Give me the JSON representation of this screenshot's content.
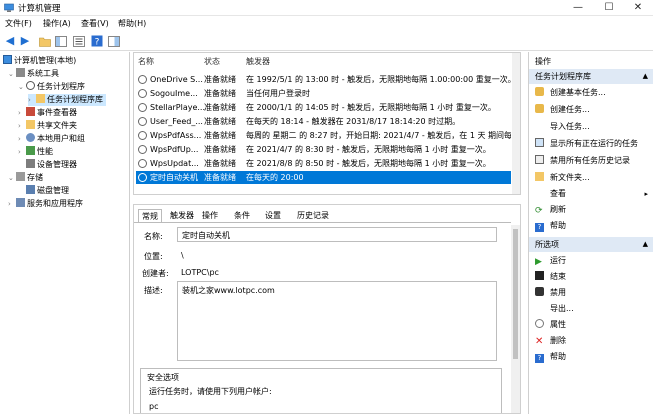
{
  "window": {
    "title": "计算机管理",
    "minimize": "—",
    "maximize": "☐",
    "close": "✕"
  },
  "menu": [
    "文件(F)",
    "操作(A)",
    "查看(V)",
    "帮助(H)"
  ],
  "tree": {
    "root": "计算机管理(本地)",
    "system_tools": "系统工具",
    "task_scheduler": "任务计划程序",
    "task_library": "任务计划程序库",
    "event_viewer": "事件查看器",
    "shared_folders": "共享文件夹",
    "local_users": "本地用户和组",
    "performance": "性能",
    "device_manager": "设备管理器",
    "storage": "存储",
    "disk_management": "磁盘管理",
    "services": "服务和应用程序"
  },
  "task_list": {
    "headers": {
      "name": "名称",
      "status": "状态",
      "triggers": "触发器"
    },
    "rows": [
      {
        "name": "OneDrive S...",
        "status": "准备就绪",
        "trigger": "在 1992/5/1 的 13:00 时 - 触发后，无限期地每隔 1.00:00:00 重复一次。"
      },
      {
        "name": "SogouIme...",
        "status": "准备就绪",
        "trigger": "当任何用户登录时"
      },
      {
        "name": "StellarPlaye...",
        "status": "准备就绪",
        "trigger": "在 2000/1/1 的 14:05 时 - 触发后，无限期地每隔 1 小时 重复一次。"
      },
      {
        "name": "User_Feed_...",
        "status": "准备就绪",
        "trigger": "在每天的 18:14 - 触发器在 2031/8/17 18:14:20 时过期。"
      },
      {
        "name": "WpsPdfAss...",
        "status": "准备就绪",
        "trigger": "每周的 星期二 的 8:27 时，开始日期: 2021/4/7 - 触发后，在 1 天 期间每"
      },
      {
        "name": "WpsPdfUp...",
        "status": "准备就绪",
        "trigger": "在 2021/4/7 的 8:30 时 - 触发后，无限期地每隔 1 小时 重复一次。"
      },
      {
        "name": "WpsUpdat...",
        "status": "准备就绪",
        "trigger": "在 2021/8/8 的 8:50 时 - 触发后，无限期地每隔 1 小时 重复一次。"
      },
      {
        "name": "定时自动关机",
        "status": "准备就绪",
        "trigger": "在每天的 20:00"
      }
    ]
  },
  "detail": {
    "tabs": [
      "常规",
      "触发器",
      "操作",
      "条件",
      "设置",
      "历史记录"
    ],
    "name_label": "名称:",
    "name_value": "定时自动关机",
    "location_label": "位置:",
    "location_value": "\\",
    "author_label": "创建者:",
    "author_value": "LOTPC\\pc",
    "description_label": "描述:",
    "description_value": "装机之家www.lotpc.com",
    "security_title": "安全选项",
    "security_text": "运行任务时，请使用下列用户帐户:",
    "security_user": "pc"
  },
  "actions": {
    "header": "操作",
    "section1": "任务计划程序库",
    "items1": [
      "创建基本任务...",
      "创建任务...",
      "导入任务...",
      "显示所有正在运行的任务",
      "禁用所有任务历史记录",
      "新文件夹...",
      "查看",
      "刷新",
      "帮助"
    ],
    "section2": "所选项",
    "items2": [
      "运行",
      "结束",
      "禁用",
      "导出...",
      "属性",
      "删除",
      "帮助"
    ]
  },
  "colors": {
    "selection": "#0078d7",
    "section_header": "#dfe9f5",
    "tree_selected": "#cce8ff"
  }
}
